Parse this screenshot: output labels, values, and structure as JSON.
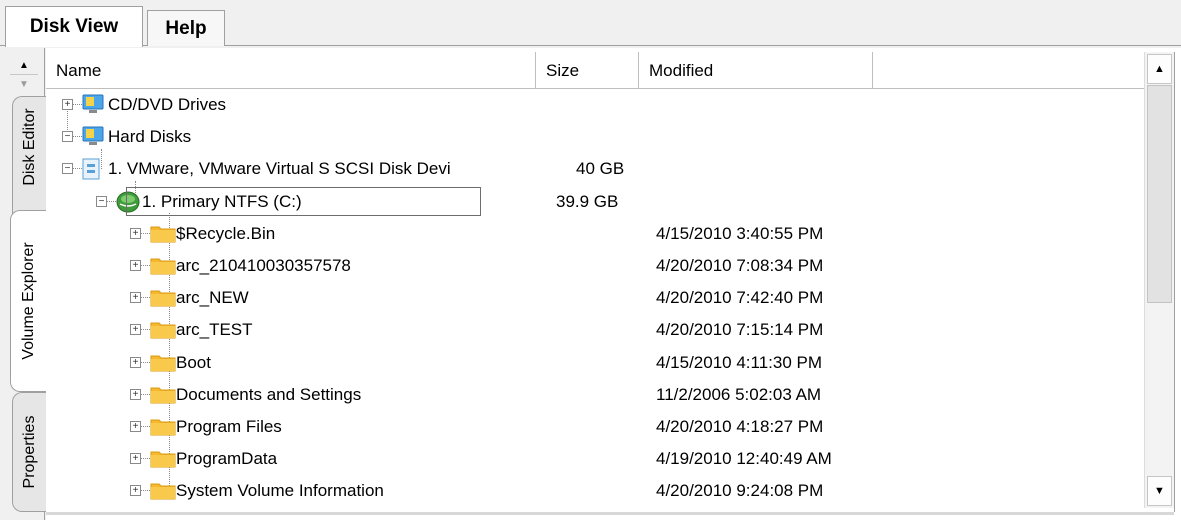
{
  "tabs": [
    "Disk View",
    "Help"
  ],
  "side_tabs": [
    "Disk Editor",
    "Volume Explorer",
    "Properties"
  ],
  "columns": {
    "name": "Name",
    "size": "Size",
    "modified": "Modified"
  },
  "rows": [
    {
      "label": "CD/DVD Drives",
      "size": "",
      "modified": "",
      "icon": "monitor-icon",
      "expander": "+"
    },
    {
      "label": "Hard Disks",
      "size": "",
      "modified": "",
      "icon": "monitor-icon",
      "expander": "−"
    },
    {
      "label": "1. VMware, VMware Virtual S SCSI Disk Devi",
      "size": "40 GB",
      "modified": "",
      "icon": "disk-icon",
      "expander": "−"
    },
    {
      "label": "1. Primary NTFS (C:)",
      "size": "39.9 GB",
      "modified": "",
      "icon": "volume-icon",
      "expander": "−"
    },
    {
      "label": "$Recycle.Bin",
      "size": "",
      "modified": "4/15/2010 3:40:55 PM",
      "icon": "folder-icon",
      "expander": "+"
    },
    {
      "label": "arc_210410030357578",
      "size": "",
      "modified": "4/20/2010 7:08:34 PM",
      "icon": "folder-icon",
      "expander": "+"
    },
    {
      "label": "arc_NEW",
      "size": "",
      "modified": "4/20/2010 7:42:40 PM",
      "icon": "folder-icon",
      "expander": "+"
    },
    {
      "label": "arc_TEST",
      "size": "",
      "modified": "4/20/2010 7:15:14 PM",
      "icon": "folder-icon",
      "expander": "+"
    },
    {
      "label": "Boot",
      "size": "",
      "modified": "4/15/2010 4:11:30 PM",
      "icon": "folder-icon",
      "expander": "+"
    },
    {
      "label": "Documents and Settings",
      "size": "",
      "modified": "11/2/2006 5:02:03 AM",
      "icon": "folder-icon",
      "expander": "+"
    },
    {
      "label": "Program Files",
      "size": "",
      "modified": "4/20/2010 4:18:27 PM",
      "icon": "folder-icon",
      "expander": "+"
    },
    {
      "label": "ProgramData",
      "size": "",
      "modified": "4/19/2010 12:40:49 AM",
      "icon": "folder-icon",
      "expander": "+"
    },
    {
      "label": "System Volume Information",
      "size": "",
      "modified": "4/20/2010 9:24:08 PM",
      "icon": "folder-icon",
      "expander": "+"
    }
  ],
  "scrollbar": {
    "up_icon": "arrow-up-icon",
    "down_icon": "arrow-down-icon"
  },
  "colors": {
    "folder": "#f5b82e",
    "monitor": "#4aa6e8",
    "volume": "#3e9c3a",
    "border": "#a0a0a0"
  }
}
